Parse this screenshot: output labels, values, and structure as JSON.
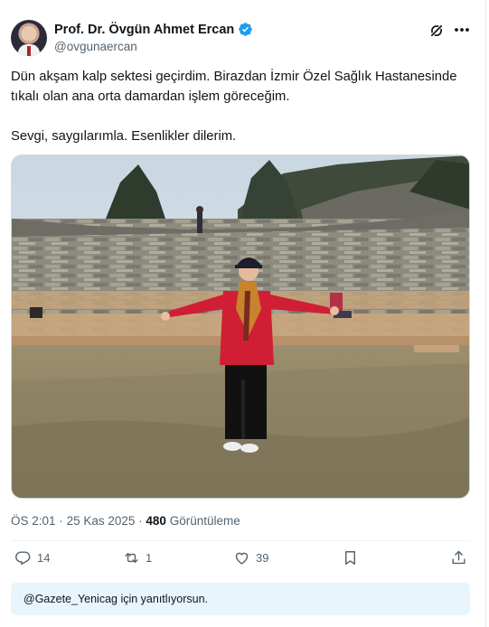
{
  "author": {
    "name": "Prof. Dr. Övgün Ahmet Ercan",
    "handle": "@ovgunaercan",
    "verified": true
  },
  "tweet": {
    "paragraphs": [
      "Dün akşam kalp sektesi geçirdim. Birazdan İzmir Özel Sağlık Hastanesinde tıkalı olan ana orta damardan işlem göreceğim.",
      "Sevgi, saygılarımla. Esenlikler dilerim."
    ],
    "photo_icon": "ancient-theater-photo"
  },
  "meta": {
    "time": "ÖS 2:01",
    "separator": "·",
    "date": "25 Kas 2025",
    "views_count": "480",
    "views_label": "Görüntüleme"
  },
  "actions": {
    "replies": "14",
    "reposts": "1",
    "likes": "39"
  },
  "reply_bar": {
    "text": "@Gazete_Yenicag için yanıtlıyorsun."
  },
  "colors": {
    "accent": "#1d9bf0",
    "secondary_text": "#536471",
    "reply_bar_bg": "#e8f5fd"
  }
}
